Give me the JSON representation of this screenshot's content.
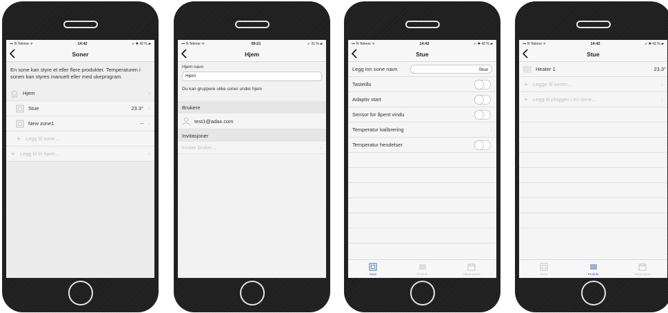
{
  "phones": [
    {
      "status": {
        "carrier": "N Telenor",
        "time": "14:42",
        "battery": "42 %"
      },
      "title": "Soner",
      "intro": "En sone kan styre et eller flere produkter. Temperaturen i sonen kan styres manuelt eller med ukeprogram.",
      "home_label": "Hjem",
      "zones": [
        {
          "name": "Stue",
          "value": "23.3°"
        },
        {
          "name": "New zone1",
          "value": "--"
        }
      ],
      "add_zone": "Legg til sone...",
      "add_home": "Legg til et hjem..."
    },
    {
      "status": {
        "carrier": "N Telenor",
        "time": "09:21",
        "battery": "31 %"
      },
      "title": "Hjem",
      "name_label": "Hjem navn",
      "name_value": "Hjem",
      "hint": "Du kan gruppere ulike soner under hjem",
      "users_header": "Brukere",
      "user_email": "test1@adax.com",
      "invites_header": "Invitasjoner",
      "invite_user": "Inviter bruker..."
    },
    {
      "status": {
        "carrier": "N Telenor",
        "time": "14:42",
        "battery": "42 %"
      },
      "title": "Stue",
      "name_row_label": "Legg inn sone navn",
      "name_row_value": "Stue",
      "rows": [
        {
          "label": "Tastelås"
        },
        {
          "label": "Adaptiv start"
        },
        {
          "label": "Sensor for åpent vindu"
        },
        {
          "label": "Temperatur kalibrering"
        },
        {
          "label": "Temperatur hendelser"
        }
      ],
      "tabs": [
        "Sone",
        "Produkt",
        "Ukeprogram"
      ]
    },
    {
      "status": {
        "carrier": "N Telenor",
        "time": "14:42",
        "battery": "42 %"
      },
      "title": "Stue",
      "heater_name": "Heater 1",
      "heater_value": "23.3°",
      "add_oven": "Legge til ovnen...",
      "add_plug": "Legg til pluggen i en sone...",
      "tabs": [
        "Sone",
        "Produkt",
        "Ukeprogram"
      ]
    }
  ],
  "colors": {
    "accent": "#2d5fa8",
    "faded": "#c0c0c0"
  }
}
